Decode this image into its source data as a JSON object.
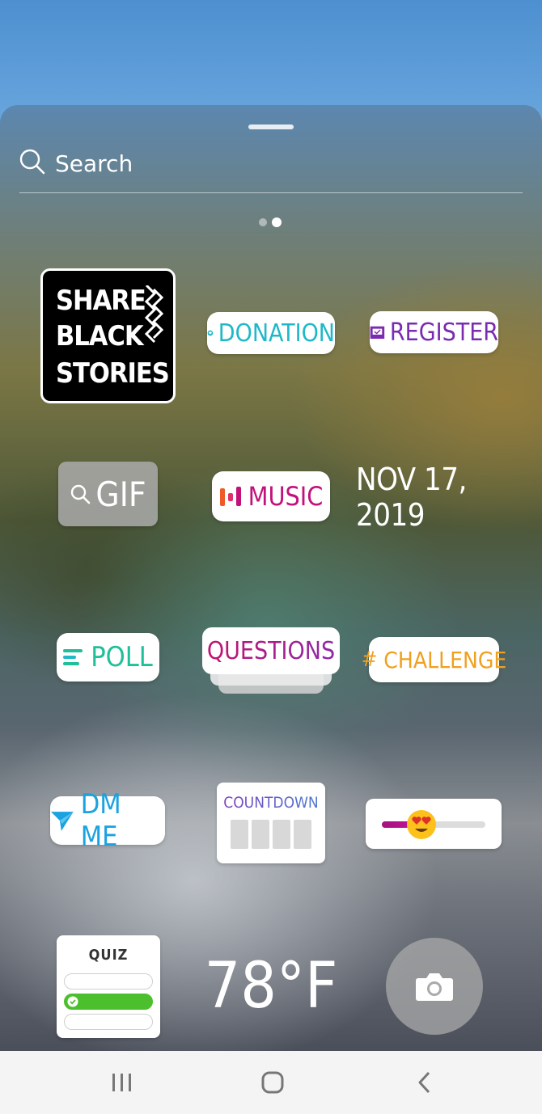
{
  "search": {
    "label": "Search"
  },
  "pager": {
    "current_page": 2,
    "total_pages": 2
  },
  "stickers": {
    "share_black_stories": {
      "lines": [
        "SHARE",
        "BLACK",
        "STORIES"
      ]
    },
    "donation": {
      "label": "DONATION",
      "color": "#1fb8c9"
    },
    "register": {
      "label": "REGISTER",
      "color": "#7a2bb0"
    },
    "gif": {
      "label": "GIF"
    },
    "music": {
      "label": "MUSIC",
      "color": "#c2127a"
    },
    "date": {
      "label": "NOV 17, 2019"
    },
    "poll": {
      "label": "POLL",
      "color": "#1fbf9a"
    },
    "questions": {
      "label": "QUESTIONS"
    },
    "challenge": {
      "label": "CHALLENGE",
      "color": "#f0a020"
    },
    "dm_me": {
      "label": "DM ME",
      "color": "#1aa3e0"
    },
    "countdown": {
      "label": "COUNTDOWN"
    },
    "emoji_slider": {
      "value": 0.38,
      "emoji": "heart-eyes-emoji"
    },
    "quiz": {
      "label": "QUIZ",
      "selected_option": 2
    },
    "temperature": {
      "label": "78°F"
    },
    "camera": {
      "icon": "camera-icon"
    }
  },
  "navbar": {
    "icons": [
      "recents-icon",
      "home-icon",
      "back-icon"
    ]
  }
}
